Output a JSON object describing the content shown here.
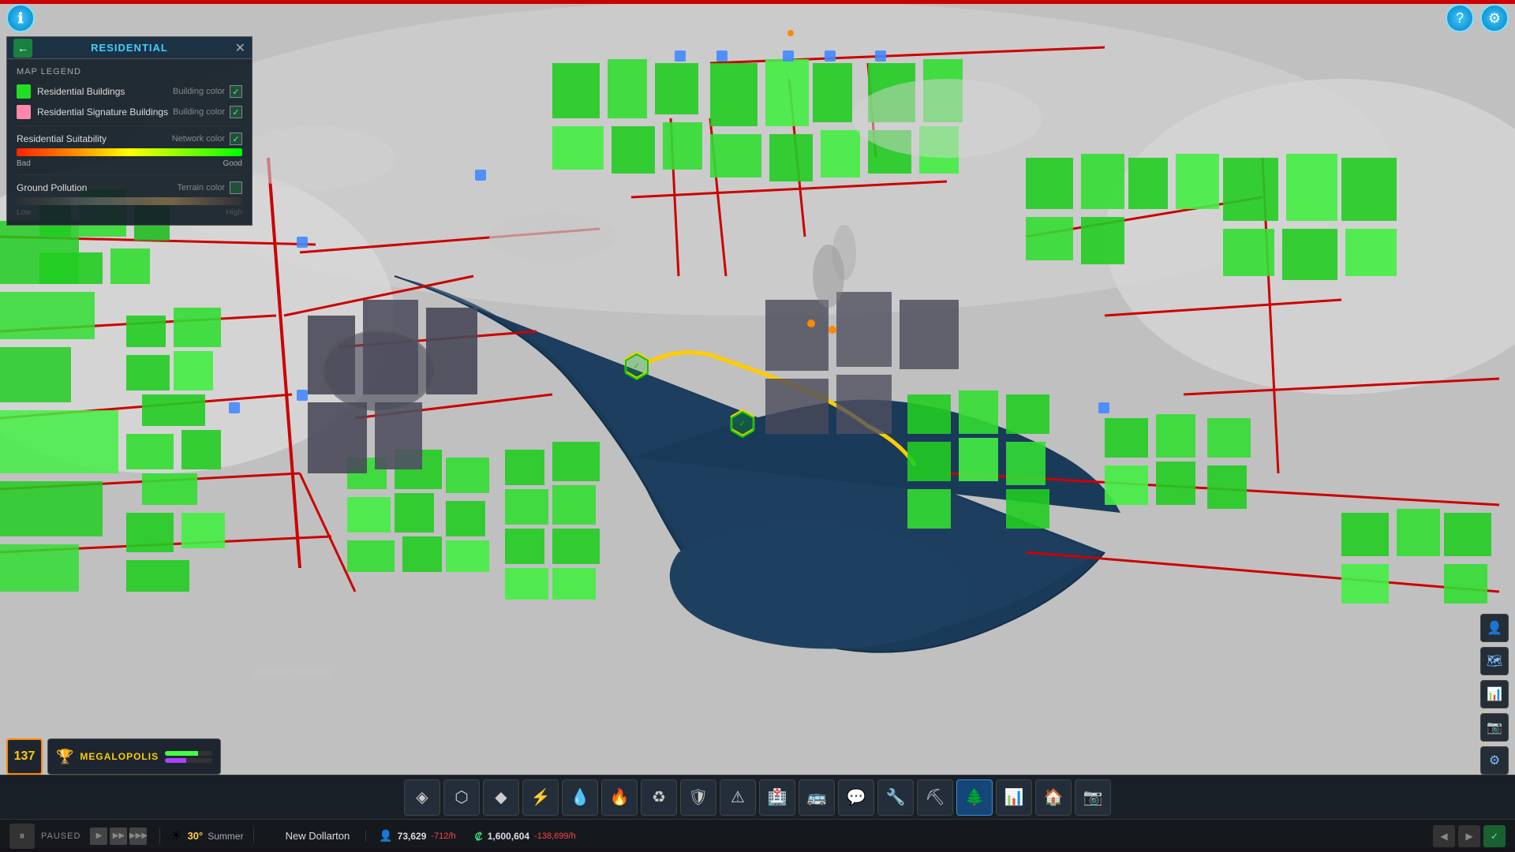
{
  "topBar": {
    "infoIcon": "ℹ",
    "helpIcon": "?",
    "settingsIcon": "⚙"
  },
  "legend": {
    "title": "RESIDENTIAL",
    "backArrow": "←",
    "closeBtn": "✕",
    "mapLegendLabel": "MAP LEGEND",
    "items": [
      {
        "id": "residential-buildings",
        "label": "Residential Buildings",
        "sublabel": "Building color",
        "color": "#22dd22",
        "checked": true
      },
      {
        "id": "signature-buildings",
        "label": "Residential Signature Buildings",
        "sublabel": "Building color",
        "color": "#ff88aa",
        "checked": true
      }
    ],
    "suitability": {
      "label": "Residential Suitability",
      "sublabel": "Network color",
      "checked": true,
      "badLabel": "Bad",
      "goodLabel": "Good"
    },
    "pollution": {
      "label": "Ground Pollution",
      "sublabel": "Terrain color",
      "checked": false,
      "lowLabel": "Low",
      "highLabel": "High"
    }
  },
  "toolbar": {
    "tools": [
      {
        "id": "zones",
        "icon": "◈",
        "label": "Zones"
      },
      {
        "id": "transport",
        "icon": "⬡",
        "label": "Transport"
      },
      {
        "id": "nature",
        "icon": "◆",
        "label": "Nature"
      },
      {
        "id": "electricity",
        "icon": "⚡",
        "label": "Electricity"
      },
      {
        "id": "water",
        "icon": "💧",
        "label": "Water"
      },
      {
        "id": "fire",
        "icon": "🔥",
        "label": "Fire"
      },
      {
        "id": "parks",
        "icon": "♻",
        "label": "Parks"
      },
      {
        "id": "police",
        "icon": "◈",
        "label": "Police"
      },
      {
        "id": "disaster",
        "icon": "⚠",
        "label": "Disaster"
      },
      {
        "id": "health",
        "icon": "🏥",
        "label": "Health"
      },
      {
        "id": "bus",
        "icon": "🚌",
        "label": "Bus"
      },
      {
        "id": "chat",
        "icon": "💬",
        "label": "Chat"
      },
      {
        "id": "tools2",
        "icon": "🔧",
        "label": "Tools"
      },
      {
        "id": "industry",
        "icon": "🏭",
        "label": "Industry"
      },
      {
        "id": "tree",
        "icon": "🌲",
        "label": "Tree"
      },
      {
        "id": "chart",
        "icon": "📊",
        "label": "Chart"
      },
      {
        "id": "house",
        "icon": "🏠",
        "label": "House"
      },
      {
        "id": "photo",
        "icon": "📷",
        "label": "Photo"
      }
    ]
  },
  "cityScore": {
    "value": "137"
  },
  "cityBadge": {
    "trophyIcon": "🏆",
    "name": "MEGALOPOLIS",
    "barGreen": 70,
    "barPurple": 45
  },
  "statusBar": {
    "pauseIcon": "⏸",
    "pausedLabel": "PAUSED",
    "speedBtns": [
      "▶",
      "▶▶",
      "▶▶▶"
    ],
    "weatherIcon": "☀",
    "temperature": "30°",
    "season": "Summer",
    "cityName": "New Dollarton",
    "population": "73,629",
    "populationChange": "-712/h",
    "populationIcon": "👤",
    "moneyIcon": "₡",
    "money": "1,600,604",
    "moneyChange": "-138,699/h",
    "moneyChangeColor": "#ff4444"
  },
  "rightIcons": [
    {
      "id": "person-icon",
      "icon": "👤"
    },
    {
      "id": "map-icon",
      "icon": "🗺"
    },
    {
      "id": "chart-icon",
      "icon": "📈"
    },
    {
      "id": "camera-icon",
      "icon": "📷"
    },
    {
      "id": "settings-sm-icon",
      "icon": "⚙"
    }
  ],
  "bottomControls": [
    {
      "id": "ctrl-1",
      "icon": "◀"
    },
    {
      "id": "ctrl-2",
      "icon": "▶"
    },
    {
      "id": "ctrl-3",
      "icon": "✓",
      "green": true
    }
  ],
  "mapLabel": "Linden Crossing"
}
